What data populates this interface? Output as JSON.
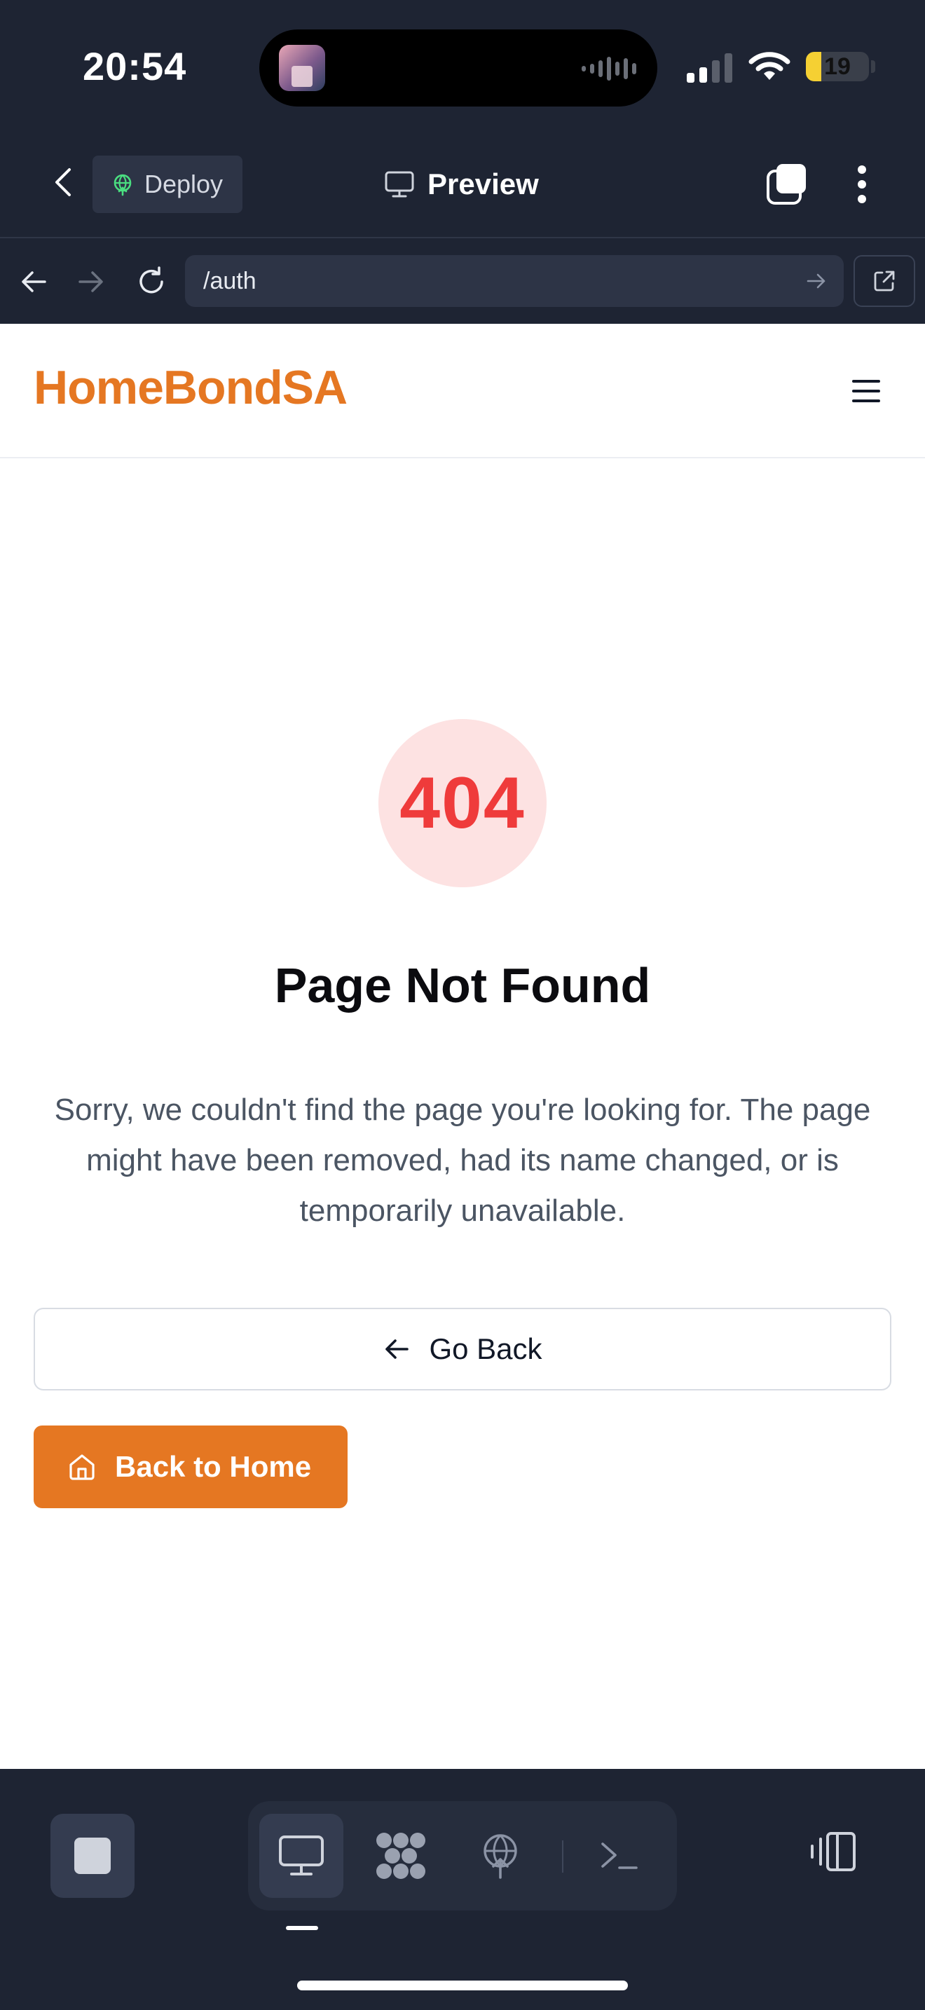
{
  "status_bar": {
    "time": "20:54",
    "battery_level": "19",
    "icons": [
      "album-art-thumbnail",
      "audio-wave-icon",
      "cellular-signal-icon",
      "wifi-icon",
      "battery-icon"
    ]
  },
  "app_header": {
    "deploy_label": "Deploy",
    "title": "Preview",
    "icons": [
      "chevron-left-icon",
      "globe-icon",
      "monitor-icon",
      "tabs-icon",
      "more-vertical-icon"
    ]
  },
  "url_bar": {
    "url": "/auth",
    "icons": [
      "arrow-left-icon",
      "arrow-right-icon",
      "reload-icon",
      "go-arrow-icon",
      "external-link-icon"
    ]
  },
  "site": {
    "brand": "HomeBondSA",
    "brand_color": "#e57722",
    "menu_icon": "hamburger-menu-icon"
  },
  "error": {
    "code": "404",
    "title": "Page Not Found",
    "message": "Sorry, we couldn't find the page you're looking for. The page might have been removed, had its name changed, or is temporarily unavailable.",
    "code_color": "#ef3b3b"
  },
  "actions": {
    "go_back_label": "Go Back",
    "home_label": "Back to Home"
  },
  "bottom_bar": {
    "active_tab": "preview",
    "icons": [
      "stop-icon",
      "monitor-icon",
      "integrations-icon",
      "deploy-globe-icon",
      "terminal-icon",
      "panel-toggle-icon"
    ]
  }
}
